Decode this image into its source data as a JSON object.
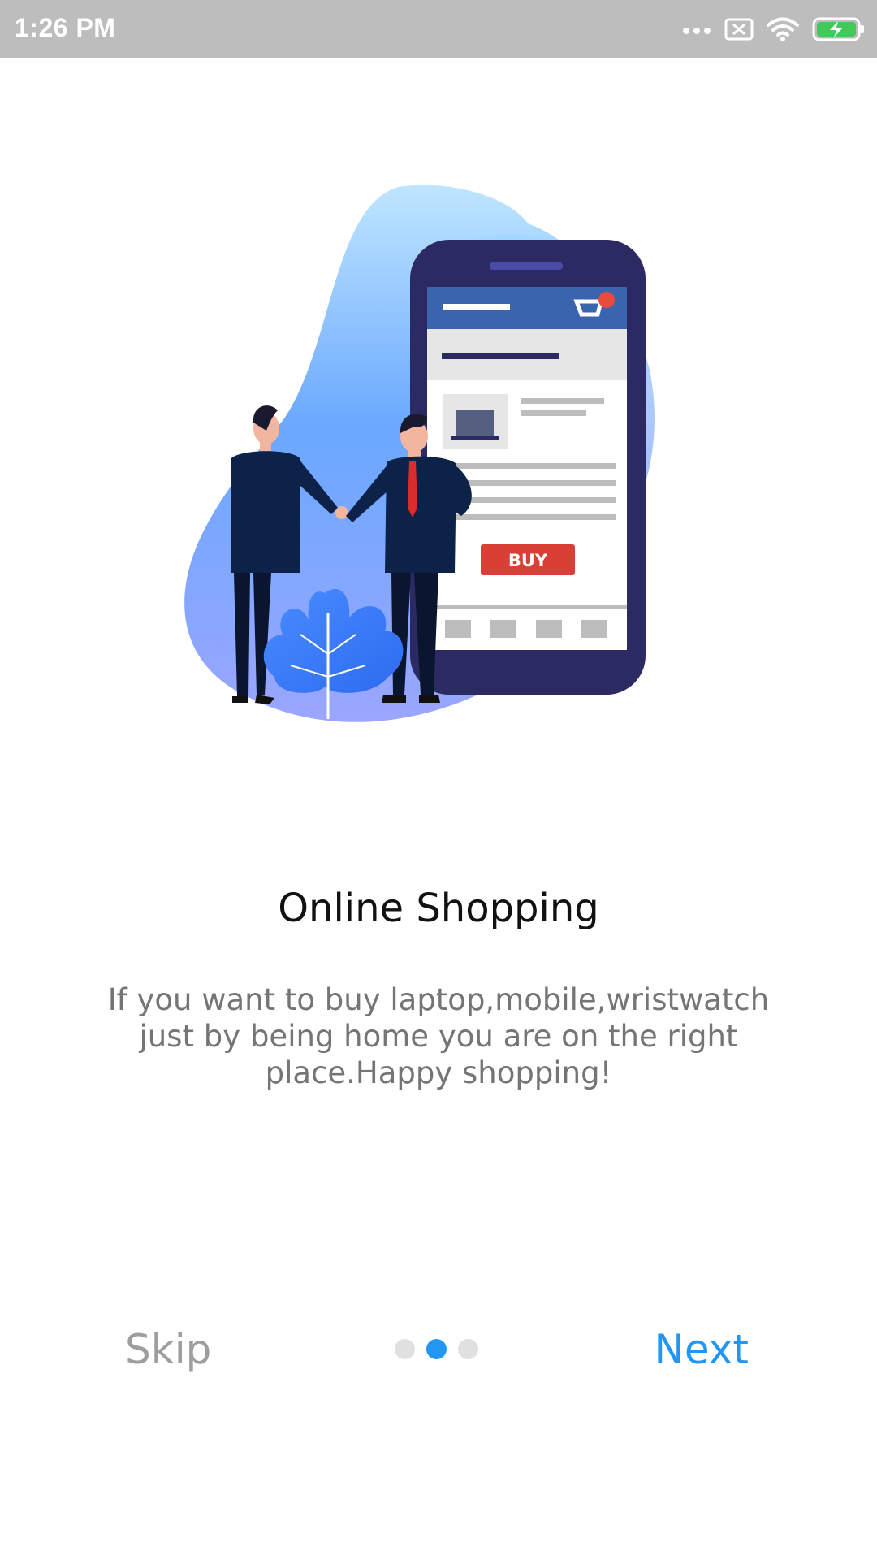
{
  "status_bar": {
    "time": "1:26 PM",
    "icons": [
      "more-dots-icon",
      "sim-x-icon",
      "wifi-icon",
      "battery-charging-icon"
    ],
    "battery_color": "#43c95a"
  },
  "illustration": {
    "button_text": "BUY",
    "icon": "handshake-phone-illustration"
  },
  "onboarding": {
    "title": "Online Shopping",
    "description": "If you want to buy laptop,mobile,wristwatch just by being home you are on the right place.Happy shopping!",
    "page_count": 3,
    "active_page": 2,
    "skip_label": "Skip",
    "next_label": "Next"
  },
  "colors": {
    "accent": "#2196f3",
    "muted": "#9e9e9e",
    "status_bar": "#bdbdbd"
  }
}
